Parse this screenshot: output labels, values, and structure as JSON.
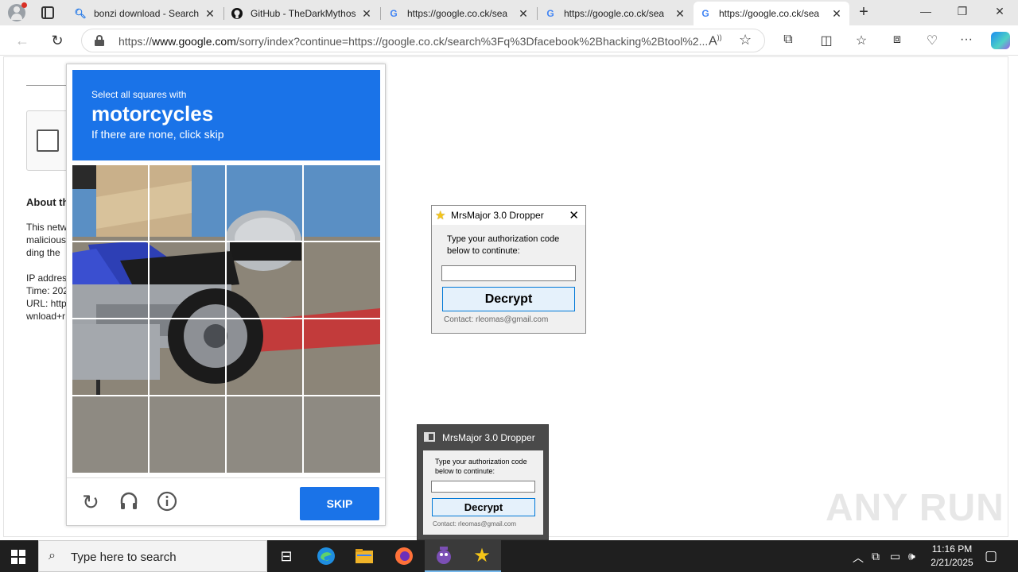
{
  "browser": {
    "tabs": [
      {
        "label": "bonzi download - Search",
        "favicon": "search-icon"
      },
      {
        "label": "GitHub - TheDarkMythos",
        "favicon": "github-icon"
      },
      {
        "label": "https://google.co.ck/sea",
        "favicon": "google-icon"
      },
      {
        "label": "https://google.co.ck/sea",
        "favicon": "google-icon"
      },
      {
        "label": "https://google.co.ck/sea",
        "favicon": "google-icon"
      }
    ],
    "url_prefix": "https://",
    "url_domain": "www.google.com",
    "url_rest": "/sorry/index?continue=https://google.co.ck/search%3Fq%3Dfacebook%2Bhacking%2Btool%2..."
  },
  "background_page": {
    "about_heading": "About th",
    "lines": [
      "This netw",
      "malicious",
      "ding the",
      "",
      "IP addres",
      "Time: 202",
      "URL: http",
      "wnload+r"
    ]
  },
  "captcha": {
    "instruction_small": "Select all squares with",
    "target": "motorcycles",
    "instruction_sub": "If there are none, click skip",
    "skip_label": "SKIP"
  },
  "dropper_active": {
    "title": "MrsMajor 3.0 Dropper",
    "prompt": "Type your authorization code below to continute:",
    "input_value": "",
    "button_label": "Decrypt",
    "contact": "Contact: rleomas@gmail.com"
  },
  "dropper_inactive": {
    "title": "MrsMajor 3.0 Dropper",
    "prompt": "Type your authorization code below to continute:",
    "input_value": "",
    "button_label": "Decrypt",
    "contact": "Contact: rleomas@gmail.com"
  },
  "watermark": "ANY RUN",
  "taskbar": {
    "search_placeholder": "Type here to search",
    "time": "11:16 PM",
    "date": "2/21/2025"
  },
  "colors": {
    "captcha_blue": "#1a73e8",
    "button_border": "#0078d7",
    "taskbar": "#1f1f1f"
  }
}
